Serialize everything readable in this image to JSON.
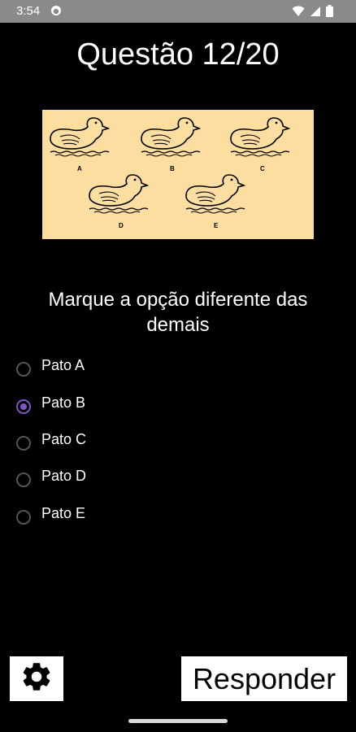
{
  "status": {
    "time": "3:54"
  },
  "quiz": {
    "title": "Questão 12/20",
    "question": "Marque a opção diferente das demais",
    "duck_labels": [
      "A",
      "B",
      "C",
      "D",
      "E"
    ],
    "options": [
      {
        "label": "Pato A",
        "selected": false
      },
      {
        "label": "Pato B",
        "selected": true
      },
      {
        "label": "Pato C",
        "selected": false
      },
      {
        "label": "Pato D",
        "selected": false
      },
      {
        "label": "Pato E",
        "selected": false
      }
    ]
  },
  "footer": {
    "answer_label": "Responder",
    "settings_icon": "gear-icon"
  },
  "colors": {
    "accent": "#7e57c2",
    "image_bg": "#fddea1",
    "status_bar": "#8a8a8a"
  }
}
